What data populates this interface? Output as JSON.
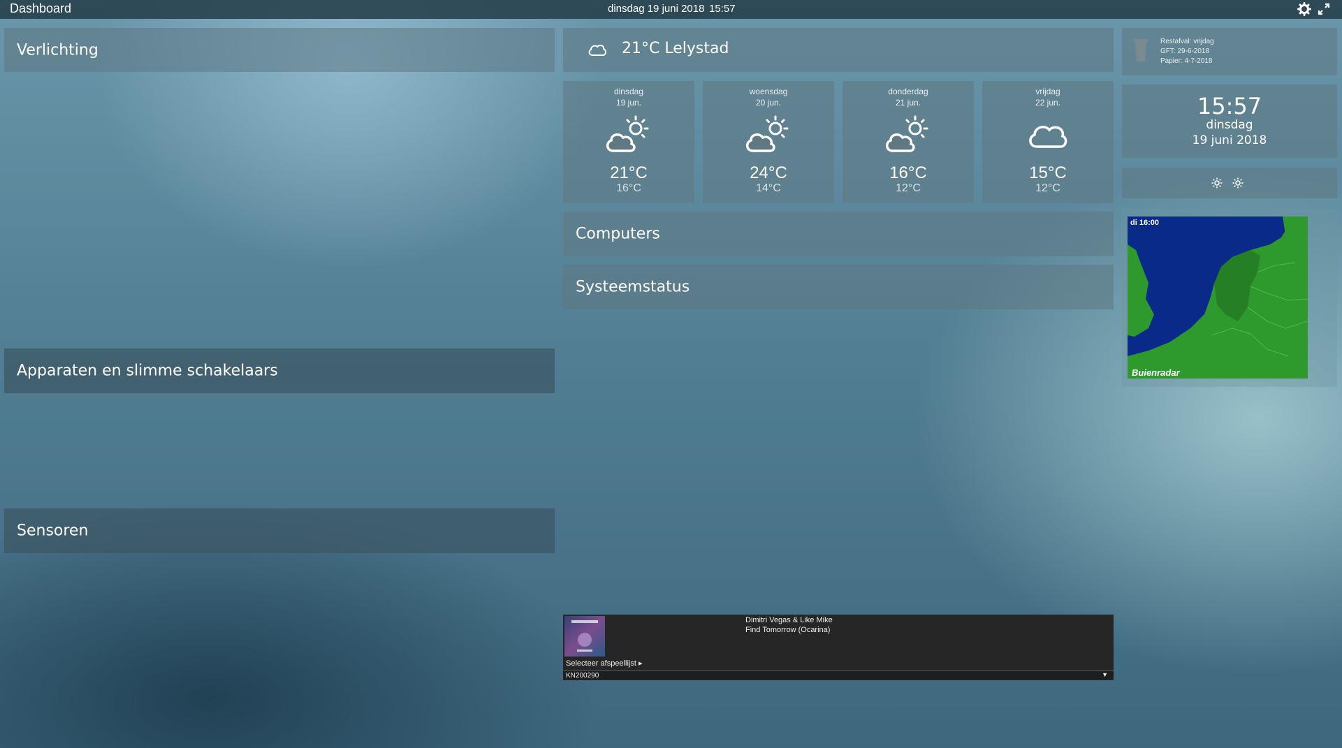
{
  "topbar": {
    "title": "Dashboard",
    "date": "dinsdag 19 juni 2018",
    "time": "15:57"
  },
  "sections": {
    "verlichting": "Verlichting",
    "apparaten": "Apparaten en slimme schakelaars",
    "sensoren": "Sensoren",
    "computers": "Computers",
    "systeemstatus": "Systeemstatus"
  },
  "weather": {
    "current": "21°C  Lelystad",
    "days": [
      {
        "name": "dinsdag",
        "date": "19 jun.",
        "max": "21°C",
        "min": "16°C",
        "icon": "partly-sunny-icon"
      },
      {
        "name": "woensdag",
        "date": "20 jun.",
        "max": "24°C",
        "min": "14°C",
        "icon": "partly-sunny-icon"
      },
      {
        "name": "donderdag",
        "date": "21 jun.",
        "max": "16°C",
        "min": "12°C",
        "icon": "partly-sunny-icon"
      },
      {
        "name": "vrijdag",
        "date": "22 jun.",
        "max": "15°C",
        "min": "12°C",
        "icon": "cloud-icon"
      }
    ]
  },
  "afval": {
    "restafval": "Restafval: vrijdag",
    "gft": "GFT: 29-6-2018",
    "papier": "Papier: 4-7-2018"
  },
  "clock": {
    "time": "15:57",
    "weekday": "dinsdag",
    "date": "19 juni 2018"
  },
  "radar": {
    "timestamp": "di 16:00",
    "brand": "Buienradar"
  },
  "player": {
    "artist": "Dimitri Vegas & Like Mike",
    "track": "Find Tomorrow (Ocarina)",
    "playlist_label": "Selecteer afspeellijst ▸",
    "device": "KN200290"
  },
  "colors": {
    "panel": "#5f7882",
    "topbar": "#233c48",
    "radar_sea": "#0a2a8a",
    "radar_land": "#2e9a2e",
    "player_bg": "#262626"
  }
}
